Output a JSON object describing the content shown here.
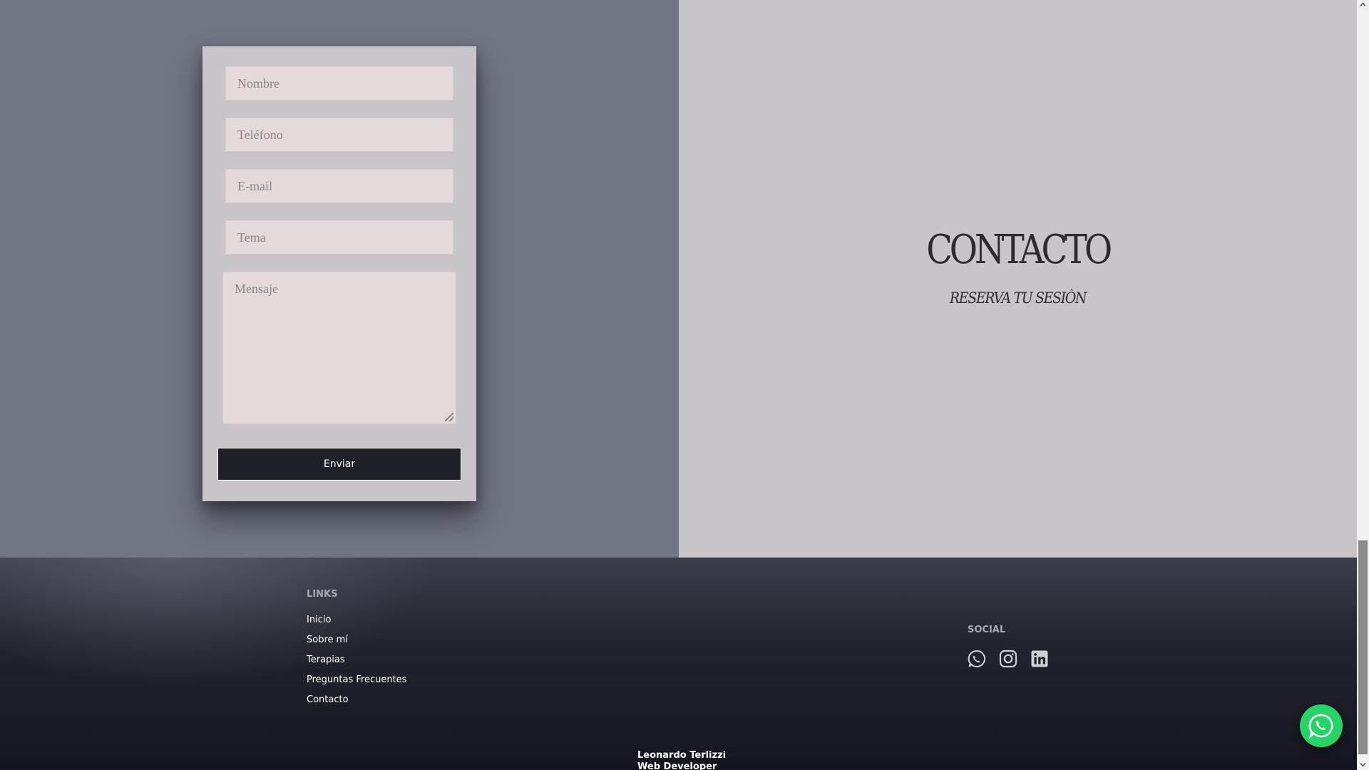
{
  "form": {
    "name_placeholder": "Nombre",
    "phone_placeholder": "Teléfono",
    "email_placeholder": "E-mail",
    "subject_placeholder": "Tema",
    "message_placeholder": "Mensaje",
    "submit_label": "Enviar"
  },
  "hero": {
    "title": "CONTACTO",
    "subtitle": "RESERVA TU SESIÒN"
  },
  "footer": {
    "links_heading": "LINKS",
    "links": [
      "Inicio",
      "Sobre mí",
      "Terapias",
      "Preguntas Frecuentes",
      "Contacto"
    ],
    "social_heading": "SOCIAL",
    "social_icons": [
      "whatsapp-icon",
      "instagram-icon",
      "linkedin-icon"
    ],
    "credit_name": "Leonardo Terlizzi",
    "credit_role": "Web Developer"
  },
  "colors": {
    "left_pane": "#727584",
    "right_pane": "#c8c4c8",
    "field_bg": "#e4dadb",
    "button_bg": "#1f2128",
    "whatsapp_green": "#25d366"
  }
}
